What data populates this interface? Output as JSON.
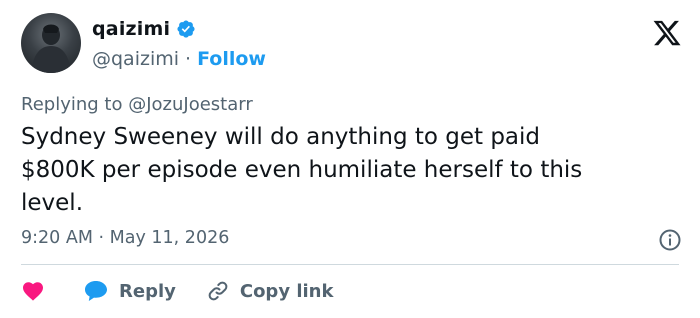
{
  "author": {
    "display_name": "qaizimi",
    "handle": "@qaizimi",
    "separator": "·",
    "follow_label": "Follow",
    "verified_color": "#1d9bf0"
  },
  "replying": {
    "prefix": "Replying to",
    "mention": "@JozuJoestarr"
  },
  "tweet": {
    "text": "Sydney Sweeney will do anything to get paid\n$800K per episode even humiliate herself to this\nlevel."
  },
  "meta": {
    "time": "9:20 AM",
    "separator": "·",
    "date": "May 11, 2026"
  },
  "actions": {
    "reply_label": "Reply",
    "copy_link_label": "Copy link",
    "like_color": "#f91880",
    "reply_color": "#1d9bf0"
  },
  "icons": {
    "brand": "x-logo-icon",
    "info": "info-icon",
    "like": "heart-icon",
    "reply": "speech-bubble-icon",
    "copy": "link-icon"
  }
}
